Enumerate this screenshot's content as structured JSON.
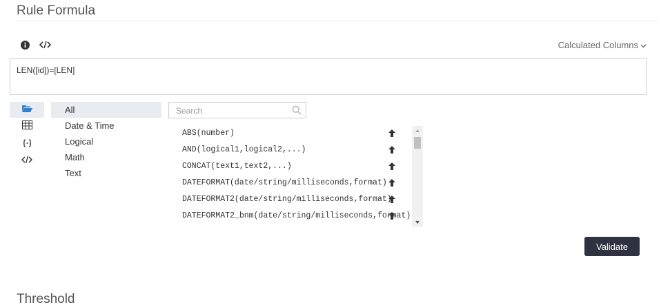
{
  "rule_formula": {
    "title": "Rule Formula",
    "toolbar": {
      "info_icon": "info-icon",
      "code_icon": "code-icon"
    },
    "calculated_columns_label": "Calculated Columns",
    "formula_value": "LEN([id])=[LEN]"
  },
  "categories": {
    "icons": [
      "folder-open-icon",
      "table-icon",
      "braces-icon",
      "code-icon"
    ],
    "items": [
      {
        "label": "All",
        "active": true
      },
      {
        "label": "Date & Time"
      },
      {
        "label": "Logical"
      },
      {
        "label": "Math"
      },
      {
        "label": "Text"
      }
    ]
  },
  "search": {
    "placeholder": "Search"
  },
  "functions": [
    "ABS(number)",
    "AND(logical1,logical2,...)",
    "CONCAT(text1,text2,...)",
    "DATEFORMAT(date/string/milliseconds,format)",
    "DATEFORMAT2(date/string/milliseconds,format)",
    "DATEFORMAT2_bnm(date/string/milliseconds,format)"
  ],
  "actions": {
    "validate_label": "Validate"
  },
  "threshold": {
    "title": "Threshold"
  },
  "colors": {
    "accent_dark": "#2e3241",
    "active_bg": "#e8ebef",
    "folder_blue": "#2f80d1"
  }
}
